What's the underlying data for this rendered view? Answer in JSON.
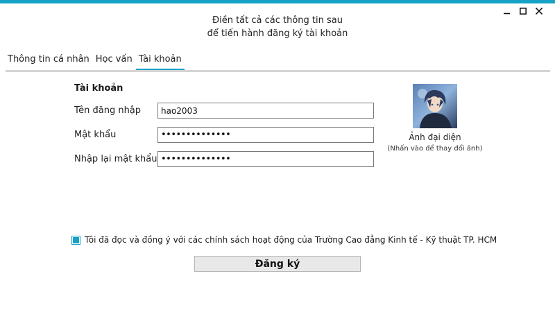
{
  "window": {
    "accent_color": "#16a2c7",
    "controls": [
      "minimize-icon",
      "maximize-icon",
      "close-icon"
    ]
  },
  "header": {
    "line1": "Điền tất cả các thông tin sau",
    "line2": "để tiến hành đăng ký tài khoản"
  },
  "tabs": [
    {
      "label": "Thông tin cá nhân",
      "active": false
    },
    {
      "label": "Học vấn",
      "active": false
    },
    {
      "label": "Tài khoản",
      "active": true
    }
  ],
  "account": {
    "section_title": "Tài khoản",
    "username_label": "Tên đăng nhập",
    "username_value": "hao2003",
    "password_label": "Mật khẩu",
    "password_value": "••••••••••••••",
    "confirm_label": "Nhập lại mật khẩu",
    "confirm_value": "••••••••••••••"
  },
  "avatar": {
    "caption": "Ảnh đại diện",
    "hint": "(Nhấn vào để thay đổi ảnh)"
  },
  "agreement": {
    "checked": true,
    "text": "Tôi đã đọc và đồng ý với các chính sách hoạt động của Trường Cao đẳng Kinh tế - Kỹ thuật TP. HCM"
  },
  "register_button": {
    "label": "Đăng ký"
  }
}
